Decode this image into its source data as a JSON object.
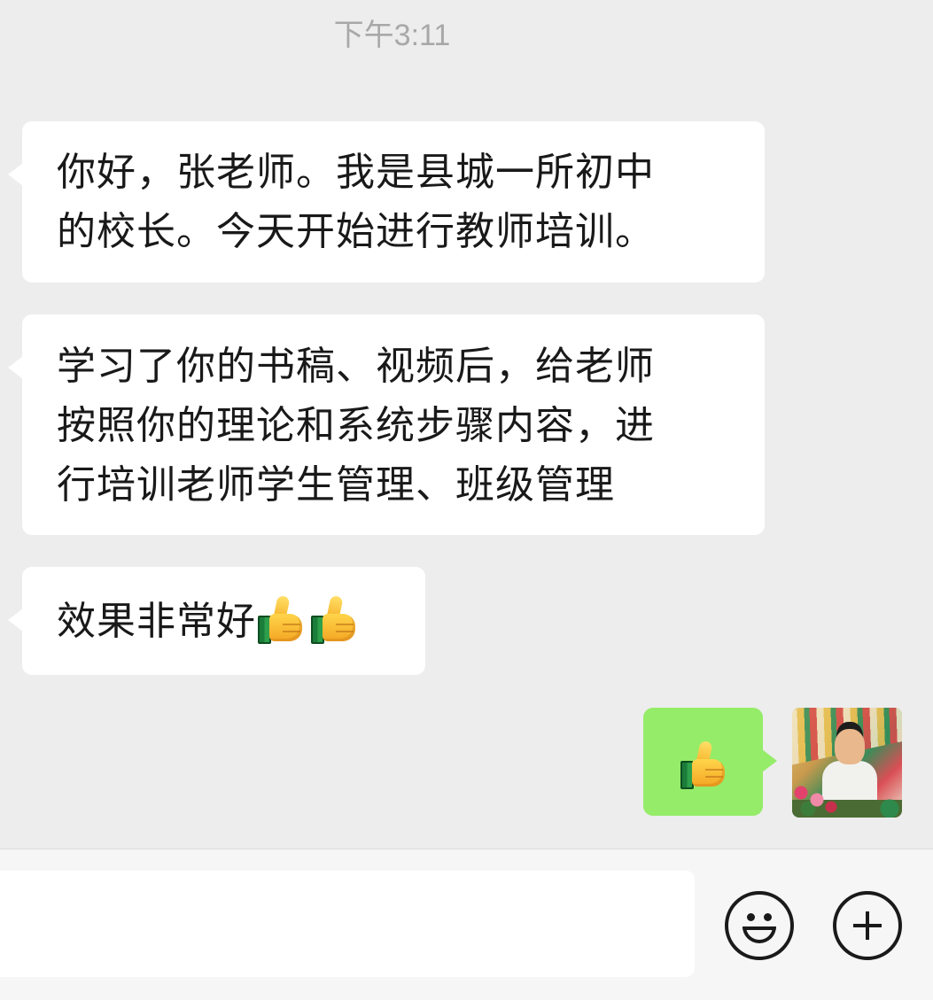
{
  "chat": {
    "timestamp": "下午3:11",
    "messages": [
      {
        "side": "left",
        "lines": [
          "你好，张老师。我是县城一所初中",
          "的校长。今天开始进行教师培训。"
        ]
      },
      {
        "side": "left",
        "lines": [
          "学习了你的书稿、视频后，给老师",
          "按照你的理论和系统步骤内容，进",
          "行培训老师学生管理、班级管理"
        ]
      },
      {
        "side": "left",
        "text": "效果非常好",
        "emojis": [
          "thumbs-up-icon",
          "thumbs-up-icon"
        ]
      },
      {
        "side": "right",
        "emojis": [
          "thumbs-up-icon"
        ]
      }
    ]
  },
  "input_bar": {
    "value": "",
    "placeholder": "",
    "icons": [
      "smiley-face-icon",
      "plus-circle-icon"
    ]
  },
  "colors": {
    "chat_background": "#ededed",
    "incoming_bubble": "#ffffff",
    "outgoing_bubble": "#95ec69",
    "timestamp_text": "#a8a8a8",
    "message_text": "#191919"
  }
}
